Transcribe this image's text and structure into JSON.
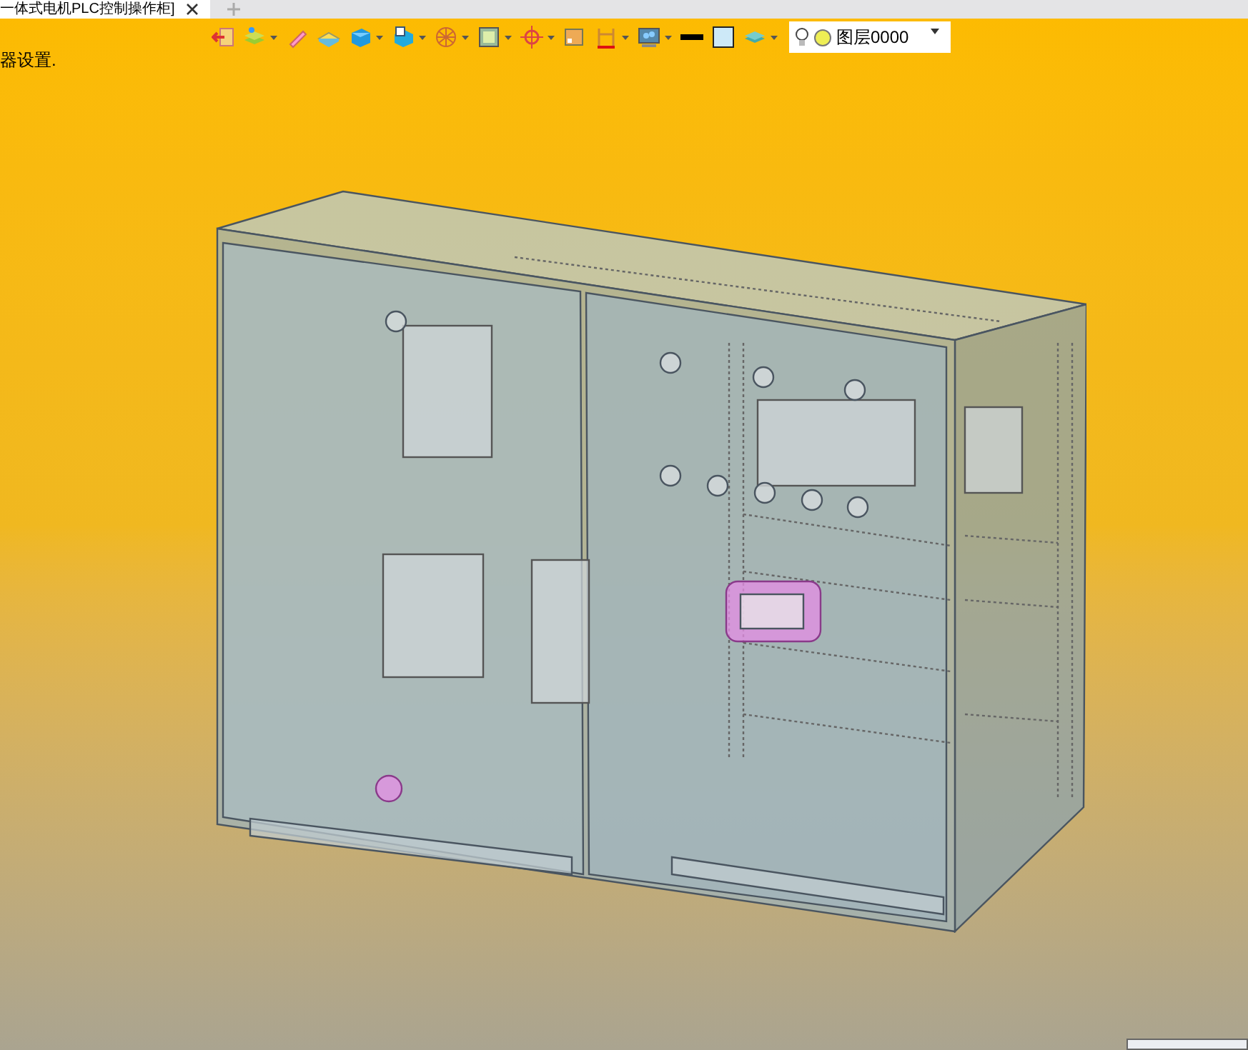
{
  "tab": {
    "title": "一体式电机PLC控制操作柜]",
    "selected": true
  },
  "prompt_text": "器设置.",
  "toolbar": [
    {
      "kind": "exit",
      "dropdown": false
    },
    {
      "kind": "layers",
      "dropdown": true
    },
    {
      "kind": "pen",
      "dropdown": false
    },
    {
      "kind": "plate",
      "dropdown": false
    },
    {
      "kind": "cube",
      "dropdown": true
    },
    {
      "kind": "view",
      "dropdown": true
    },
    {
      "kind": "wire",
      "dropdown": true
    },
    {
      "kind": "frame",
      "dropdown": true
    },
    {
      "kind": "target",
      "dropdown": true
    },
    {
      "kind": "square",
      "dropdown": false
    },
    {
      "kind": "dimension",
      "dropdown": true
    },
    {
      "kind": "monitor",
      "dropdown": true
    },
    {
      "kind": "line",
      "dropdown": false
    },
    {
      "kind": "fill",
      "dropdown": false
    },
    {
      "kind": "stack",
      "dropdown": true
    }
  ],
  "layer_select": {
    "value": "图层0000"
  }
}
